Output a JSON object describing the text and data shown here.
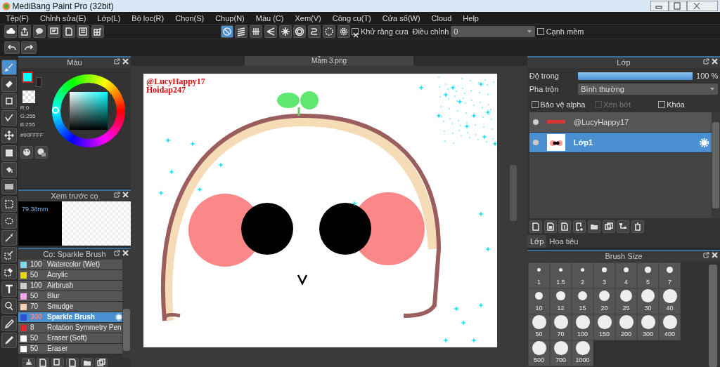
{
  "window": {
    "title": "MediBang Paint Pro (32bit)"
  },
  "menu": [
    "Tệp(F)",
    "Chỉnh sửa(E)",
    "Lớp(L)",
    "Bộ lọc(R)",
    "Chọn(S)",
    "Chụp(N)",
    "Màu (C)",
    "Xem(V)",
    "Công cụ(T)",
    "Cửa sổ(W)",
    "Cloud",
    "Help"
  ],
  "snap_modes": [
    {
      "kind": "off",
      "selected": true
    },
    {
      "kind": "parallel",
      "selected": false
    },
    {
      "kind": "grid",
      "selected": false
    },
    {
      "kind": "focus",
      "selected": false
    },
    {
      "kind": "radial",
      "selected": false
    },
    {
      "kind": "concentric",
      "selected": false
    },
    {
      "kind": "curve",
      "selected": false
    },
    {
      "kind": "circle",
      "selected": false
    },
    {
      "kind": "settings",
      "selected": false
    }
  ],
  "antialias": {
    "label": "Khử răng cưa",
    "checked": true
  },
  "adjust": {
    "label": "Điều chỉnh",
    "value": "0"
  },
  "soft_edge": {
    "label": "Cạnh mềm",
    "checked": false
  },
  "tools": [
    {
      "kind": "brush",
      "selected": true
    },
    {
      "kind": "eraser",
      "selected": false
    },
    {
      "kind": "shape",
      "selected": false
    },
    {
      "kind": "polyline",
      "selected": false
    },
    {
      "kind": "move",
      "selected": false
    },
    {
      "kind": "fill",
      "selected": false
    },
    {
      "kind": "bucket",
      "selected": false
    },
    {
      "kind": "gradient",
      "selected": false
    },
    {
      "kind": "select",
      "selected": false
    },
    {
      "kind": "lasso",
      "selected": false
    },
    {
      "kind": "wand",
      "selected": false
    },
    {
      "kind": "selpen",
      "selected": false
    },
    {
      "kind": "selerase",
      "selected": false
    },
    {
      "kind": "text",
      "selected": false
    },
    {
      "kind": "operation",
      "selected": false
    },
    {
      "kind": "pen",
      "selected": false
    },
    {
      "kind": "dropper",
      "selected": false
    }
  ],
  "color_panel": {
    "title": "Màu",
    "color": "#00ffff",
    "r": "R:0",
    "g": "G:255",
    "b": "B:255",
    "hex": "#00FFFF"
  },
  "preview_panel": {
    "title": "Xem trước cọ",
    "size": "79.38mm"
  },
  "brush_panel": {
    "title": "Cọ: Sparkle Brush",
    "brushes": [
      {
        "size": "100",
        "name": "Watercolor (Wet)",
        "color": "#7fd8ec",
        "selected": false
      },
      {
        "size": "50",
        "name": "Acrylic",
        "color": "#e6d800",
        "selected": false
      },
      {
        "size": "100",
        "name": "Airbrush",
        "color": "#cccccc",
        "selected": false
      },
      {
        "size": "50",
        "name": "Blur",
        "color": "#f2a6ee",
        "selected": false
      },
      {
        "size": "70",
        "name": "Smudge",
        "color": "#f5d2b8",
        "selected": false
      },
      {
        "size": "300",
        "name": "Sparkle Brush",
        "color": "#2f4fe0",
        "selected": true
      },
      {
        "size": "8",
        "name": "Rotation Symmetry Pen",
        "color": "#e02828",
        "selected": false
      },
      {
        "size": "50",
        "name": "Eraser (Soft)",
        "color": "#ffffff",
        "selected": false
      },
      {
        "size": "50",
        "name": "Eraser",
        "color": "#ffffff",
        "selected": false
      }
    ]
  },
  "document": {
    "tab": "Mẫm 3.png",
    "canvas_texts": [
      "@LucyHappy17",
      "Hoidap247"
    ]
  },
  "layer_panel": {
    "title": "Lớp",
    "opacity_label": "Độ trong",
    "level": 1.0,
    "opacity_reading": "100 %",
    "blend_label": "Pha trộn",
    "blend_value": "Bình thường",
    "options": [
      {
        "label": "Bảo vệ alpha",
        "checked": false,
        "disabled": false
      },
      {
        "label": "Xén bớt",
        "checked": false,
        "disabled": true
      },
      {
        "label": "Khóa",
        "checked": false,
        "disabled": false
      }
    ],
    "layers": [
      {
        "name": "@LucyHappy17",
        "selected": false
      },
      {
        "name": "Lớp1",
        "selected": true
      }
    ],
    "tabs": [
      {
        "label": "Lớp",
        "selected": true
      },
      {
        "label": "Hoa tiêu",
        "selected": false
      }
    ]
  },
  "brush_size": {
    "title": "Brush Size",
    "sizes": [
      "1",
      "1.5",
      "2",
      "3",
      "4",
      "5",
      "7",
      "10",
      "12",
      "15",
      "20",
      "25",
      "30",
      "40",
      "50",
      "70",
      "100",
      "150",
      "200",
      "300",
      "400",
      "500",
      "700",
      "1000"
    ]
  }
}
